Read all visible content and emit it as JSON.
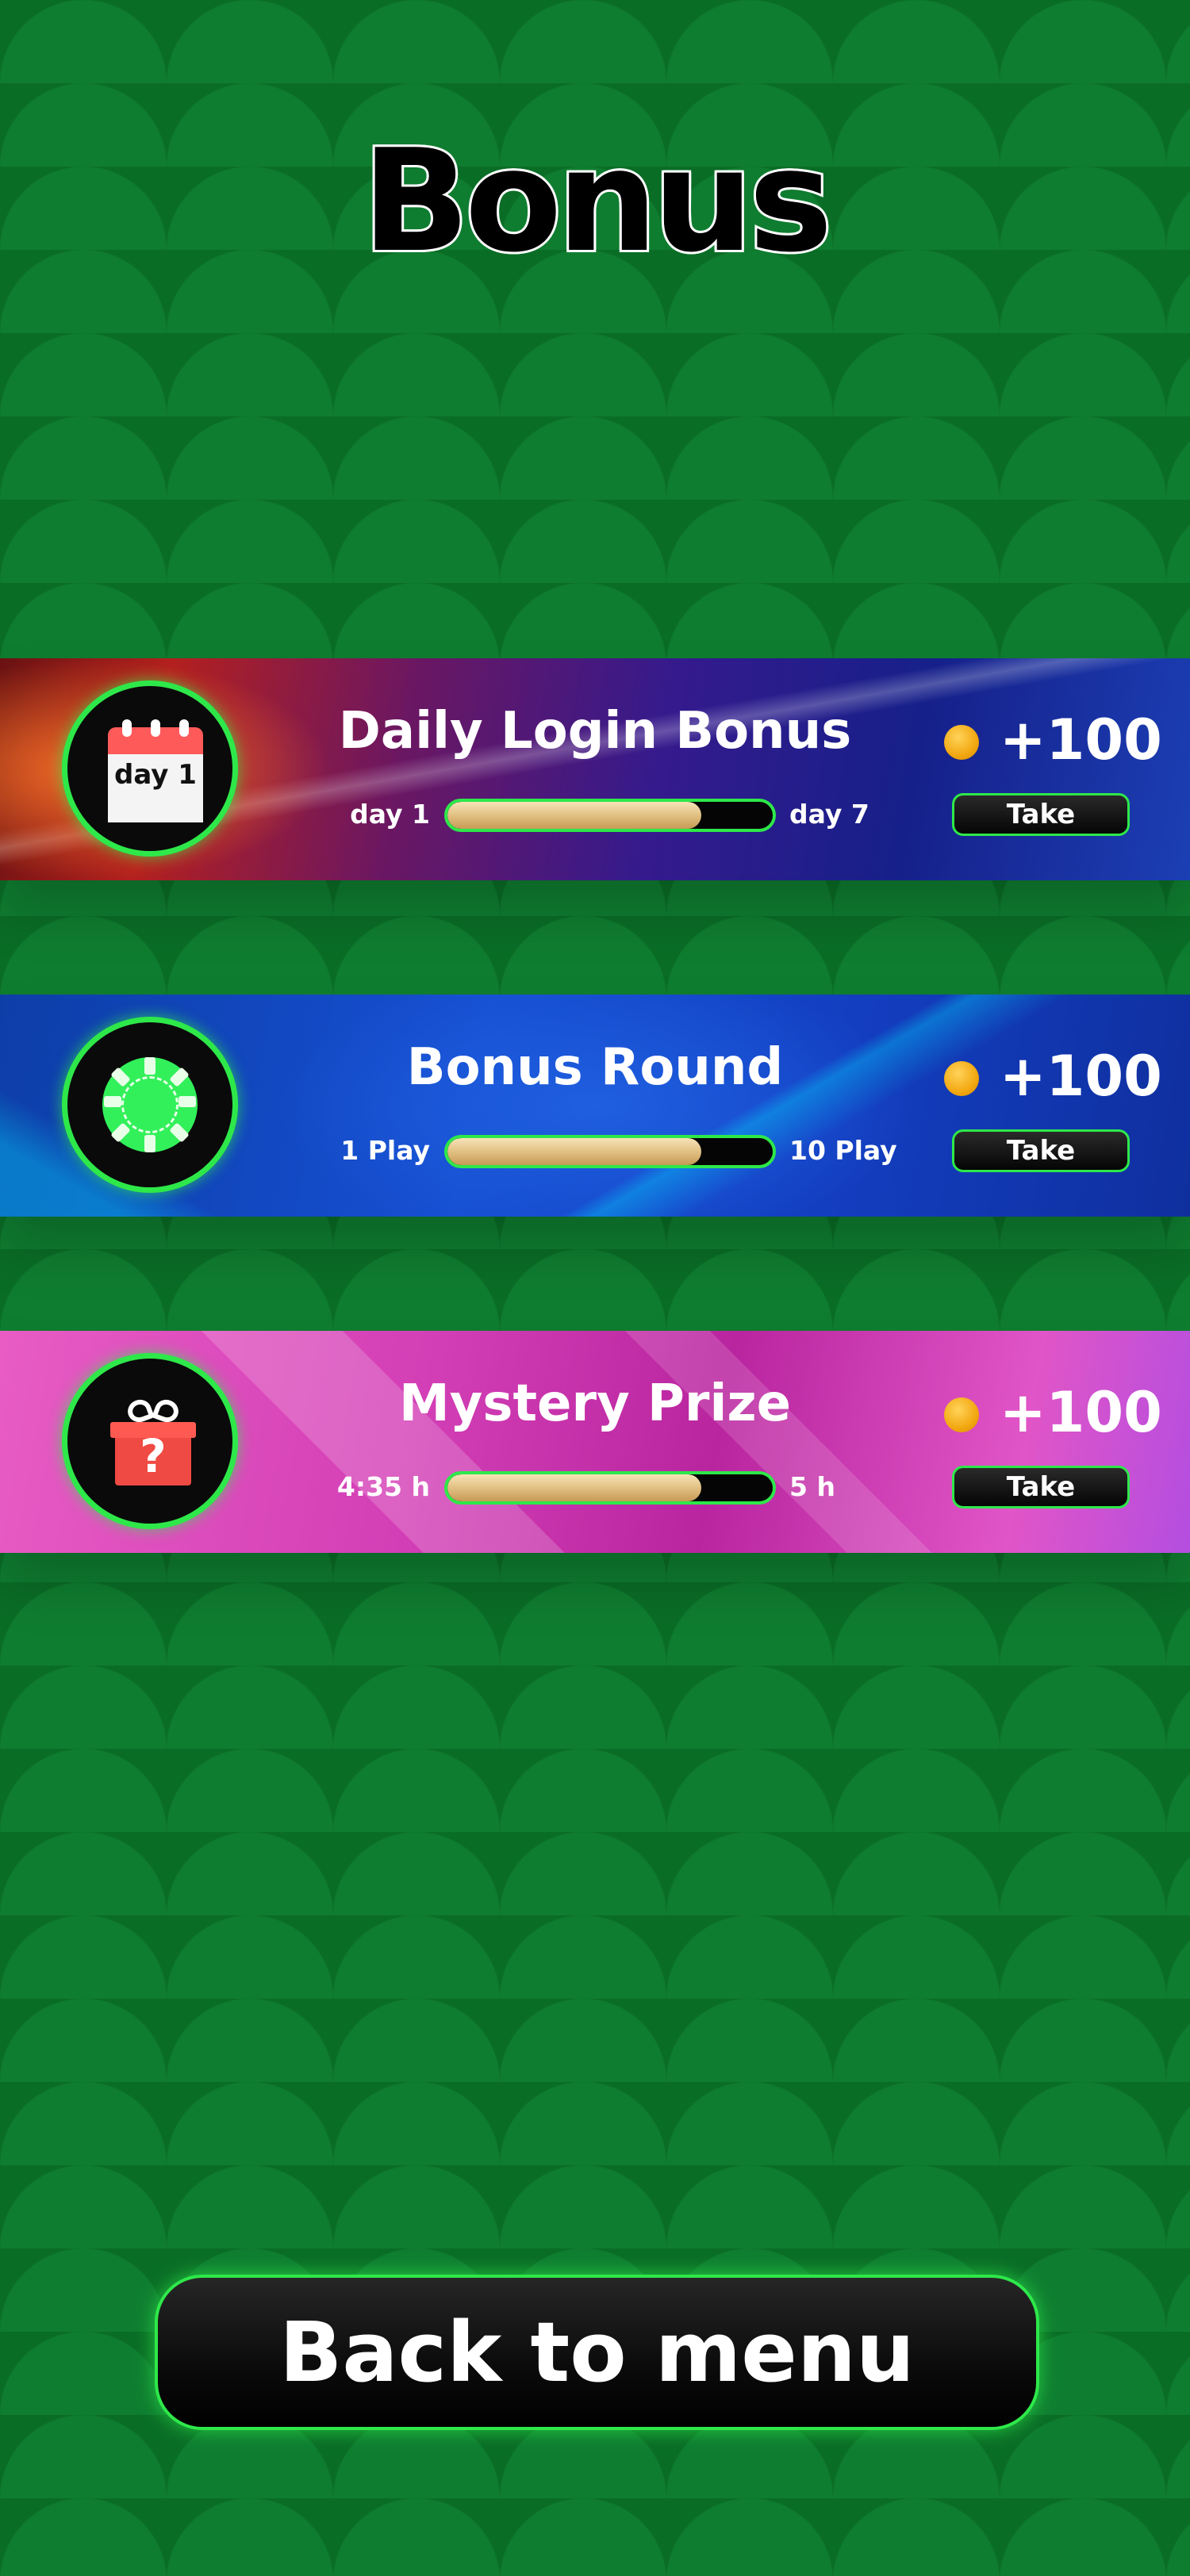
{
  "page": {
    "title": "Bonus"
  },
  "bonuses": [
    {
      "title": "Daily Login Bonus",
      "icon": "calendar-icon",
      "icon_label": "day 1",
      "progress_min": "day 1",
      "progress_max": "day 7",
      "progress": 0.78,
      "reward": "+100",
      "take_label": "Take"
    },
    {
      "title": "Bonus Round",
      "icon": "poker-chip-icon",
      "progress_min": "1 Play",
      "progress_max": "10 Play",
      "progress": 0.78,
      "reward": "+100",
      "take_label": "Take"
    },
    {
      "title": "Mystery Prize",
      "icon": "gift-icon",
      "icon_label": "?",
      "progress_min": "4:35 h",
      "progress_max": "5 h",
      "progress": 0.78,
      "reward": "+100",
      "take_label": "Take"
    }
  ],
  "footer": {
    "back_label": "Back to menu"
  },
  "colors": {
    "accent": "#2ee84a",
    "background": "#0a6d26",
    "coin": "#f3a811",
    "progress_fill": "#e4c488"
  }
}
